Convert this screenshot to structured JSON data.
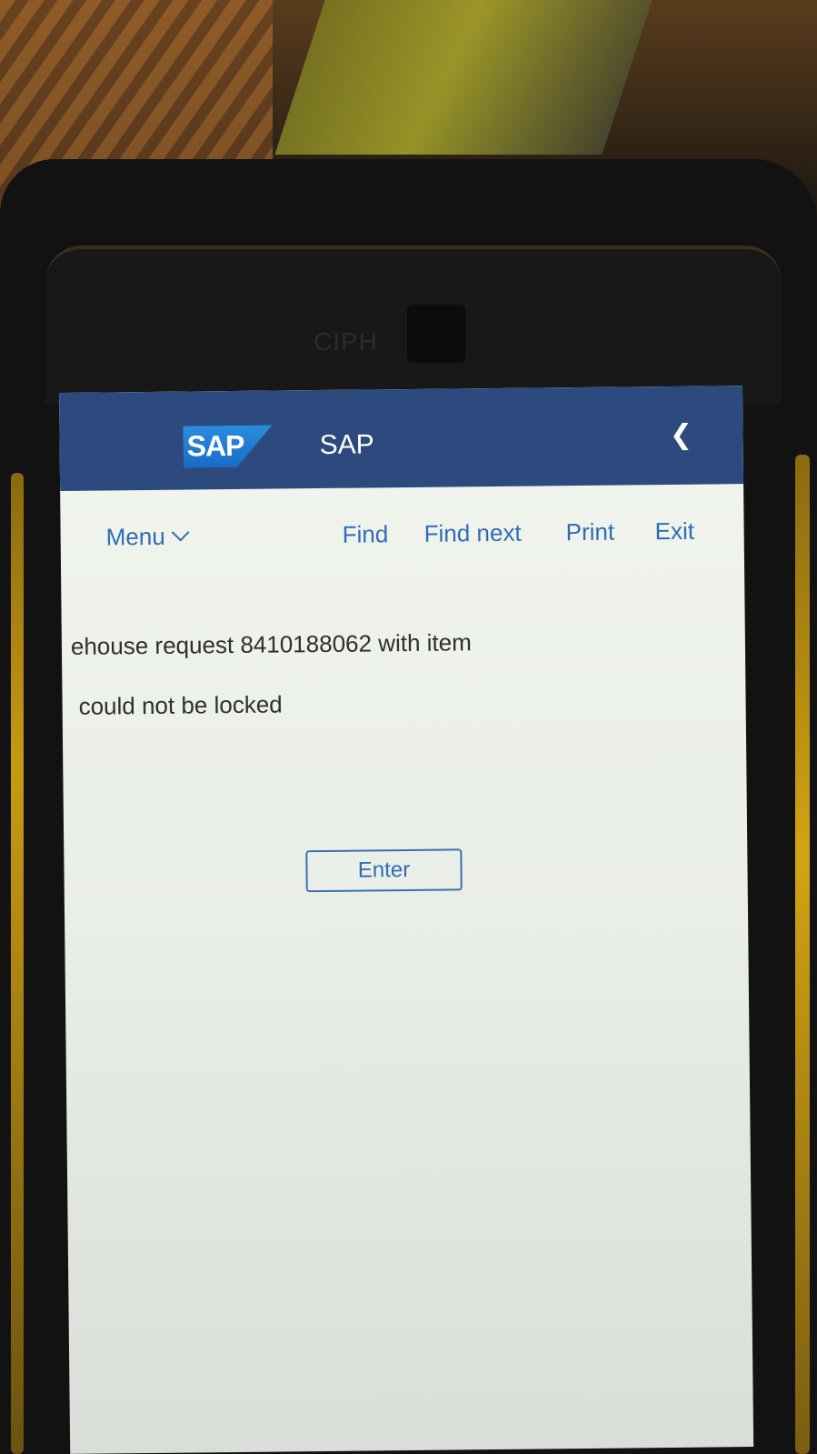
{
  "shell": {
    "logo": "SAP",
    "title": "SAP"
  },
  "device": {
    "brand": "CIPH"
  },
  "toolbar": {
    "menu_label": "Menu",
    "find_label": "Find",
    "find_next_label": "Find next",
    "print_label": "Print",
    "exit_label": "Exit"
  },
  "message": {
    "line1": "ehouse request 8410188062 with item",
    "line2": "could not be locked"
  },
  "actions": {
    "enter_label": "Enter"
  },
  "icons": {
    "back": "chevron-left-icon",
    "menu_dropdown": "chevron-down-icon"
  },
  "colors": {
    "shellbar": "#2c4a7e",
    "link": "#2f6db3",
    "screen_bg": "#f1f5ee"
  }
}
